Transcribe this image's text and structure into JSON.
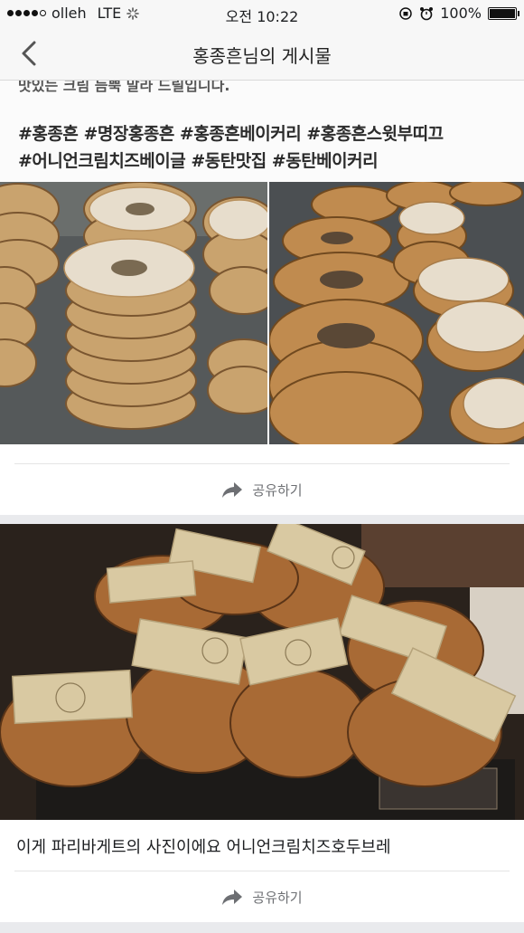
{
  "status_bar": {
    "carrier": "olleh",
    "network": "LTE",
    "time": "오전 10:22",
    "battery": "100%"
  },
  "nav": {
    "title": "홍종흔님의 게시물"
  },
  "post1": {
    "cut_line": "맛있는 크림 듬뿍 말라 드릴입니다.",
    "hashtags_line1": "#홍종흔  #명장홍종흔  #홍종흔베이커리  #홍종흔스윗부띠끄",
    "hashtags_line2": "#어니언크림치즈베이글  #동탄맛집  #동탄베이커리",
    "share_label": "공유하기"
  },
  "post2": {
    "caption": "이게 파리바게트의 사진이에요 어니언크림치즈호두브레",
    "share_label": "공유하기"
  },
  "colors": {
    "background": "#e9eaed",
    "bar": "#f7f7f7",
    "share_text": "#6d6f73"
  }
}
